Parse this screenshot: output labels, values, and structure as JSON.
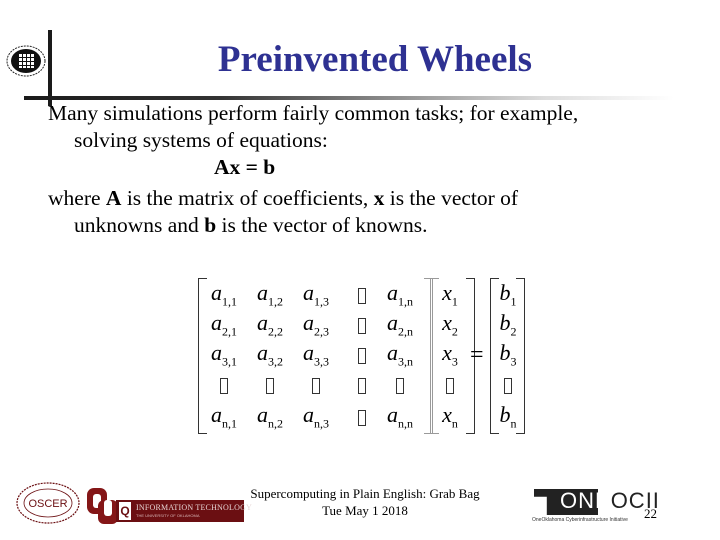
{
  "slide": {
    "title": "Preinvented Wheels",
    "title_color": "#2e3192",
    "body": {
      "line1": "Many simulations perform fairly common tasks; for example,",
      "line2": "solving systems of equations:",
      "equation": "Ax = b",
      "line3_pre": "where ",
      "line3_A": "A",
      "line3_mid1": " is the matrix of coefficients, ",
      "line3_x": "x",
      "line3_mid2": " is the vector of",
      "line4_pre": "unknowns and ",
      "line4_b": "b",
      "line4_post": " is the vector of knowns."
    },
    "matrix": {
      "rows": [
        [
          {
            "v": "a",
            "s": "1,1"
          },
          {
            "v": "a",
            "s": "1,2"
          },
          {
            "v": "a",
            "s": "1,3"
          },
          {
            "dots": true
          },
          {
            "v": "a",
            "s": "1,n"
          }
        ],
        [
          {
            "v": "a",
            "s": "2,1"
          },
          {
            "v": "a",
            "s": "2,2"
          },
          {
            "v": "a",
            "s": "2,3"
          },
          {
            "dots": true
          },
          {
            "v": "a",
            "s": "2,n"
          }
        ],
        [
          {
            "v": "a",
            "s": "3,1"
          },
          {
            "v": "a",
            "s": "3,2"
          },
          {
            "v": "a",
            "s": "3,3"
          },
          {
            "dots": true
          },
          {
            "v": "a",
            "s": "3,n"
          }
        ],
        [
          {
            "dots": true
          },
          {
            "dots": true
          },
          {
            "dots": true
          },
          {
            "dots": true
          },
          {
            "dots": true
          }
        ],
        [
          {
            "v": "a",
            "s": "n,1"
          },
          {
            "v": "a",
            "s": "n,2"
          },
          {
            "v": "a",
            "s": "n,3"
          },
          {
            "dots": true
          },
          {
            "v": "a",
            "s": "n,n"
          }
        ]
      ],
      "x_vector": [
        {
          "v": "x",
          "s": "1"
        },
        {
          "v": "x",
          "s": "2"
        },
        {
          "v": "x",
          "s": "3"
        },
        {
          "dots": true
        },
        {
          "v": "x",
          "s": "n"
        }
      ],
      "equals": "=",
      "b_vector": [
        {
          "v": "b",
          "s": "1"
        },
        {
          "v": "b",
          "s": "2"
        },
        {
          "v": "b",
          "s": "3"
        },
        {
          "dots": true
        },
        {
          "v": "b",
          "s": "n"
        }
      ]
    }
  },
  "footer": {
    "line1": "Supercomputing in Plain English: Grab Bag",
    "line2": "Tue May 1 2018",
    "page_number": "22",
    "logos": {
      "oscer": "OSCER",
      "ou": "OU",
      "it_title": "INFORMATION TECHNOLOGY",
      "it_subtitle": "THE UNIVERSITY OF OKLAHOMA",
      "it_color": "#6b0f12",
      "oneocii_one": "ONE",
      "oneocii_ocii": "OCII",
      "oneocii_tagline": "OneOklahoma Cyberinfrastructure Initiative"
    }
  }
}
